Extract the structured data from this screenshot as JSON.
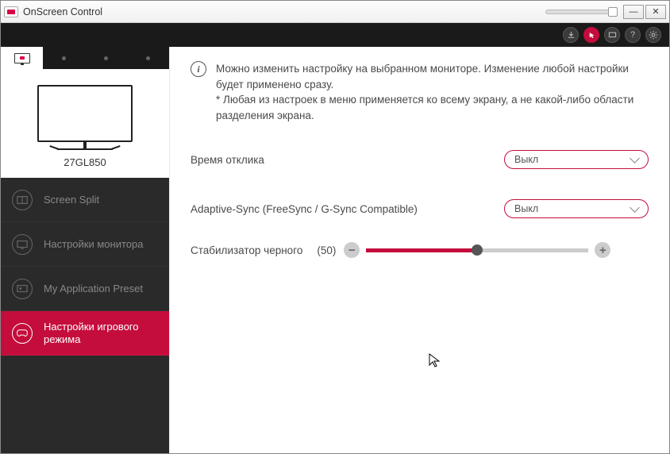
{
  "titlebar": {
    "title": "OnScreen Control"
  },
  "monitor": {
    "model": "27GL850"
  },
  "sidebar": {
    "items": [
      {
        "label": "Screen Split"
      },
      {
        "label": "Настройки монитора"
      },
      {
        "label": "My Application Preset"
      },
      {
        "label": "Настройки игрового режима"
      }
    ]
  },
  "info": {
    "line1": "Можно изменить настройку на выбранном мониторе. Изменение любой настройки будет применено сразу.",
    "line2": "* Любая из настроек в меню применяется ко всему экрану, а не какой-либо области разделения экрана."
  },
  "settings": {
    "response_time": {
      "label": "Время отклика",
      "value": "Выкл"
    },
    "adaptive_sync": {
      "label": "Adaptive-Sync (FreeSync / G-Sync Compatible)",
      "value": "Выкл"
    },
    "black_stabilizer": {
      "label": "Стабилизатор черного",
      "value_display": "(50)",
      "value": 50,
      "min": 0,
      "max": 100
    }
  }
}
